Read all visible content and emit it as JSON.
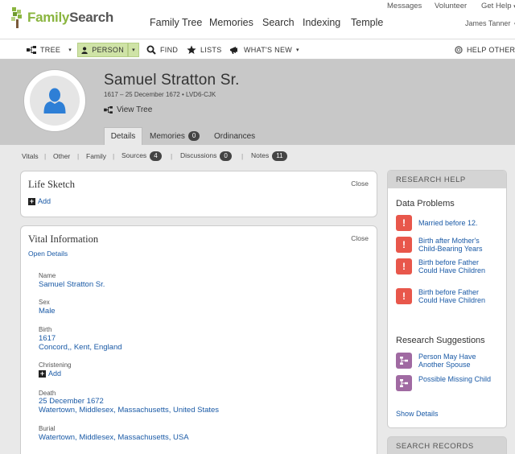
{
  "brand": {
    "family": "Family",
    "search": "Search"
  },
  "utility_links": [
    "Messages",
    "Volunteer",
    "Get Help"
  ],
  "utility_caret": "▾",
  "main_nav": [
    "Family Tree",
    "Memories",
    "Search",
    "Indexing",
    "Temple"
  ],
  "user": {
    "name": "James Tanner",
    "caret": "▾"
  },
  "toolbar": {
    "tree": "TREE",
    "person": "PERSON",
    "find": "FIND",
    "lists": "LISTS",
    "whats_new": "WHAT'S NEW",
    "help_others": "HELP OTHERS",
    "caret": "▾"
  },
  "person": {
    "name": "Samuel Stratton Sr.",
    "dates_id": "1617 – 25 December 1672 • LVD6-CJK",
    "view_tree": "View Tree"
  },
  "tabs": [
    {
      "label": "Details"
    },
    {
      "label": "Memories",
      "count": "0"
    },
    {
      "label": "Ordinances"
    }
  ],
  "subnav": [
    {
      "label": "Vitals"
    },
    {
      "label": "Other"
    },
    {
      "label": "Family"
    },
    {
      "label": "Sources",
      "count": "4"
    },
    {
      "label": "Discussions",
      "count": "0"
    },
    {
      "label": "Notes",
      "count": "11"
    }
  ],
  "subnav_sep": "|",
  "life_sketch": {
    "title": "Life Sketch",
    "close": "Close",
    "add": "Add"
  },
  "vital_info": {
    "title": "Vital Information",
    "close": "Close",
    "open_details": "Open Details",
    "name_label": "Name",
    "name_value": "Samuel Stratton Sr.",
    "sex_label": "Sex",
    "sex_value": "Male",
    "birth_label": "Birth",
    "birth_date": "1617",
    "birth_place": "Concord,, Kent, England",
    "christening_label": "Christening",
    "christening_add": "Add",
    "death_label": "Death",
    "death_date": "25 December 1672",
    "death_place": "Watertown, Middlesex, Massachusetts, United States",
    "burial_label": "Burial",
    "burial_place": "Watertown, Middlesex, Massachusetts, USA"
  },
  "research_help": {
    "header": "RESEARCH HELP",
    "data_problems_title": "Data Problems",
    "problem_icon": "!",
    "problems": [
      "Married before 12.",
      "Birth after Mother's Child-Bearing Years",
      "Birth before Father Could Have Children",
      "Birth before Father Could Have Children"
    ],
    "suggestions_title": "Research Suggestions",
    "suggestions": [
      "Person May Have Another Spouse",
      "Possible Missing Child"
    ],
    "show_details": "Show Details"
  },
  "search_records": {
    "header": "SEARCH RECORDS"
  },
  "plus_glyph": "+",
  "colors": {
    "link": "#1a5aa6",
    "brand_green": "#8ab53f",
    "problem_red": "#e8574b",
    "suggestion_purple": "#a06aa2",
    "avatar_blue": "#2e7fd6"
  },
  "icons": {
    "logo": "tree-logo-icon",
    "tree": "pedigree-icon",
    "person": "person-icon",
    "find": "magnifier-icon",
    "lists": "star-icon",
    "whats_new": "megaphone-icon",
    "help_others": "lifebuoy-icon",
    "problem": "exclamation-icon",
    "suggestion": "pedigree-icon"
  }
}
